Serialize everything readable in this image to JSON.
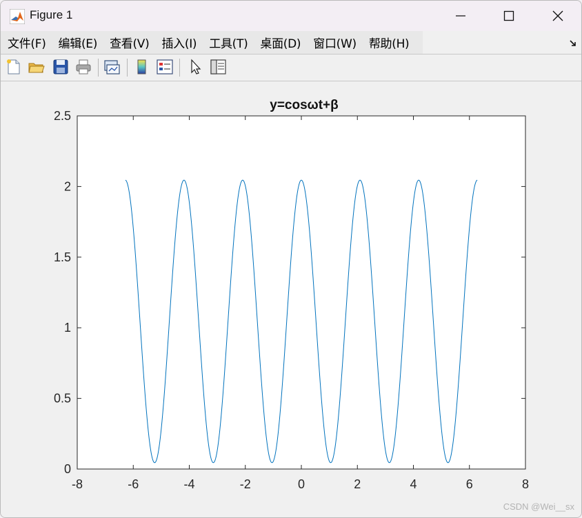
{
  "window": {
    "title": "Figure 1",
    "controls": {
      "minimize": "—",
      "maximize": "☐",
      "close": "✕"
    }
  },
  "menu": {
    "items": [
      "文件(F)",
      "编辑(E)",
      "查看(V)",
      "插入(I)",
      "工具(T)",
      "桌面(D)",
      "窗口(W)",
      "帮助(H)"
    ]
  },
  "toolbar": {
    "icons": [
      "new-figure-icon",
      "open-file-icon",
      "save-icon",
      "print-icon",
      "link-plot-icon",
      "colorbar-icon",
      "legend-icon",
      "pointer-icon",
      "property-editor-icon"
    ]
  },
  "watermark": "CSDN @Wei__sx",
  "chart_data": {
    "type": "line",
    "title": "y=cosωt+β",
    "xlabel": "",
    "ylabel": "",
    "xlim": [
      -8,
      8
    ],
    "ylim": [
      0,
      2.5
    ],
    "xticks": [
      "-8",
      "-6",
      "-4",
      "-2",
      "0",
      "2",
      "4",
      "6",
      "8"
    ],
    "yticks": [
      "0",
      "0.5",
      "1",
      "1.5",
      "2",
      "2.5"
    ],
    "grid": false,
    "series": [
      {
        "color": "#0072BD",
        "function": "1.045 + cos(3t)",
        "t_range": [
          -6.28,
          6.28
        ],
        "y_max": 2.045,
        "y_min": 0.045
      }
    ]
  }
}
